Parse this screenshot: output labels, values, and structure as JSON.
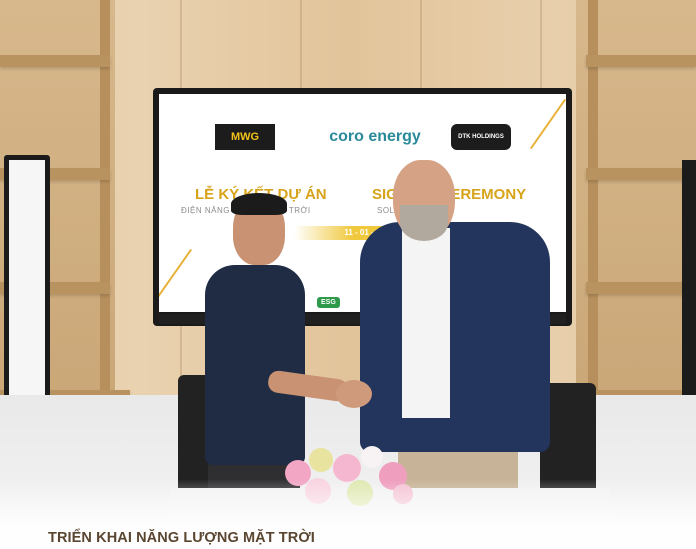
{
  "caption": "TRIỂN KHAI NĂNG LƯỢNG MẶT TRỜI",
  "screen": {
    "logo_left": "MWG",
    "logo_center": "coro energy",
    "logo_right": "DTK HOLDINGS",
    "title_vn": "LỄ KÝ KẾT DỰ ÁN",
    "title_en": "SIGNING CEREMONY",
    "subtitle_vn": "ĐIỆN NĂNG LƯỢNG MẶT TRỜI",
    "subtitle_en": "SOLAR PROJECT",
    "date": "11 - 01 - 2024",
    "badge": "ESG"
  },
  "colors": {
    "caption": "#5a4630",
    "accent_gold": "#d7a319",
    "jacket": "#23355c"
  }
}
